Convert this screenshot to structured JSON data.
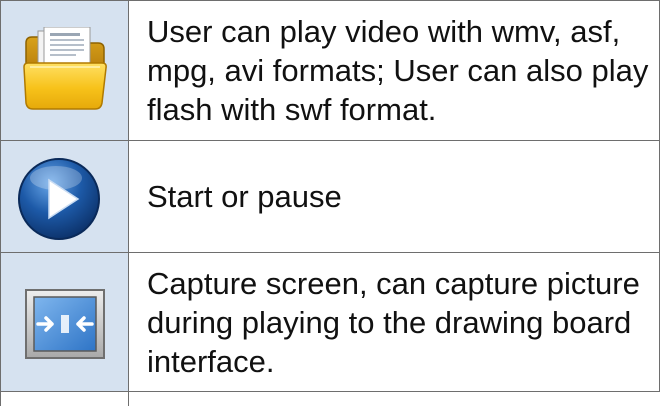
{
  "rows": [
    {
      "icon": "open-folder-icon",
      "text": "User can play video with wmv, asf, mpg, avi formats; User can also play flash with swf format."
    },
    {
      "icon": "play-pause-icon",
      "text": "Start or pause"
    },
    {
      "icon": "capture-screen-icon",
      "text": "Capture screen, can capture picture during playing to the drawing board interface."
    }
  ],
  "colors": {
    "icon_cell_bg": "#d6e2f0",
    "folder_yellow": "#f7c21a",
    "play_blue": "#1d5aa8",
    "capture_blue": "#3a86d8"
  }
}
